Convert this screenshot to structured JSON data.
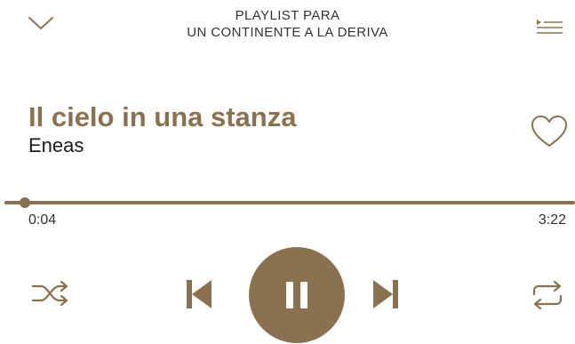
{
  "header": {
    "title_line1": "PLAYLIST PARA",
    "title_line2": "UN CONTINENTE A LA DERIVA",
    "collapse_icon": "chevron-down-icon",
    "queue_icon": "queue-icon"
  },
  "track": {
    "title": "Il cielo in una stanza",
    "artist": "Eneas",
    "liked": false
  },
  "progress": {
    "elapsed": "0:04",
    "duration": "3:22",
    "fraction": 0.02
  },
  "controls": {
    "shuffle_icon": "shuffle-icon",
    "previous_icon": "skip-previous-icon",
    "pause_icon": "pause-icon",
    "next_icon": "skip-next-icon",
    "repeat_icon": "repeat-icon"
  },
  "colors": {
    "accent": "#8a7251",
    "icon": "#8a7251",
    "text": "#222222"
  }
}
